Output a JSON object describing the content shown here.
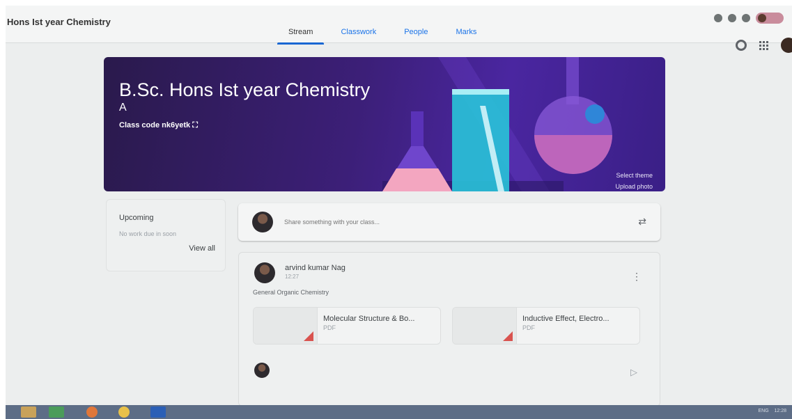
{
  "header": {
    "class_title": "Hons Ist year Chemistry",
    "tabs": [
      {
        "label": "Stream"
      },
      {
        "label": "Classwork"
      },
      {
        "label": "People"
      },
      {
        "label": "Marks"
      }
    ]
  },
  "banner": {
    "title": "B.Sc. Hons Ist year Chemistry",
    "section": "A",
    "class_code_label": "Class code",
    "class_code": "nk6yetk",
    "select_theme": "Select theme",
    "upload_photo": "Upload photo"
  },
  "upcoming": {
    "title": "Upcoming",
    "empty_text": "No work due in soon",
    "view_all": "View all"
  },
  "share": {
    "placeholder": "Share something with your class..."
  },
  "post": {
    "author": "arvind kumar Nag",
    "time": "12:27",
    "text": "General Organic Chemistry",
    "attachments": [
      {
        "title": "Molecular Structure & Bo...",
        "type": "PDF"
      },
      {
        "title": "Inductive Effect, Electro...",
        "type": "PDF"
      }
    ]
  },
  "taskbar": {
    "lang": "ENG",
    "time": "12:28"
  },
  "colors": {
    "banner": "#3c1f78",
    "tab_active_underline": "#1967d2",
    "taskbar": "#5d6d86"
  },
  "icons": {
    "settings": "gear-icon",
    "apps": "apps-grid-icon",
    "more": "more-vert-icon",
    "send": "send-icon",
    "repost": "repost-icon"
  }
}
